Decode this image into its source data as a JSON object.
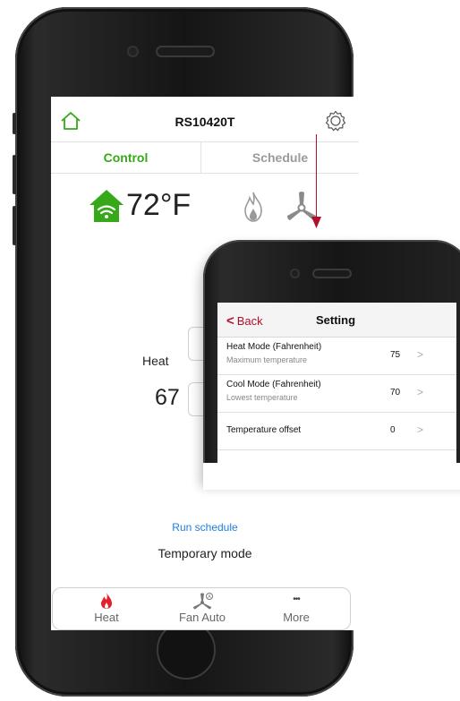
{
  "main_app": {
    "title": "RS10420T",
    "tabs": {
      "control": "Control",
      "schedule": "Schedule"
    },
    "current_temperature": "72°F",
    "mode_label": "Heat",
    "setpoint": "67",
    "increase_label": "+",
    "decrease_label": "-",
    "run_schedule": "Run schedule",
    "temporary_mode": "Temporary mode",
    "bottom_tabs": {
      "heat": "Heat",
      "fan": "Fan Auto",
      "more": "More"
    },
    "more_glyph": "•••",
    "colors": {
      "accent_green": "#37a818",
      "link_blue": "#1e7fe0",
      "flame_red": "#e4202a"
    }
  },
  "settings_screen": {
    "back_label": "Back",
    "back_glyph": "<",
    "title": "Setting",
    "rows": [
      {
        "title": "Heat Mode (Fahrenheit)",
        "subtitle": "Maximum temperature",
        "value": "75",
        "chevron": ">"
      },
      {
        "title": "Cool Mode (Fahrenheit)",
        "subtitle": "Lowest temperature",
        "value": "70",
        "chevron": ">"
      },
      {
        "title": "Temperature offset",
        "value": "0",
        "chevron": ">"
      }
    ],
    "colors": {
      "back_red": "#b5102a"
    }
  }
}
